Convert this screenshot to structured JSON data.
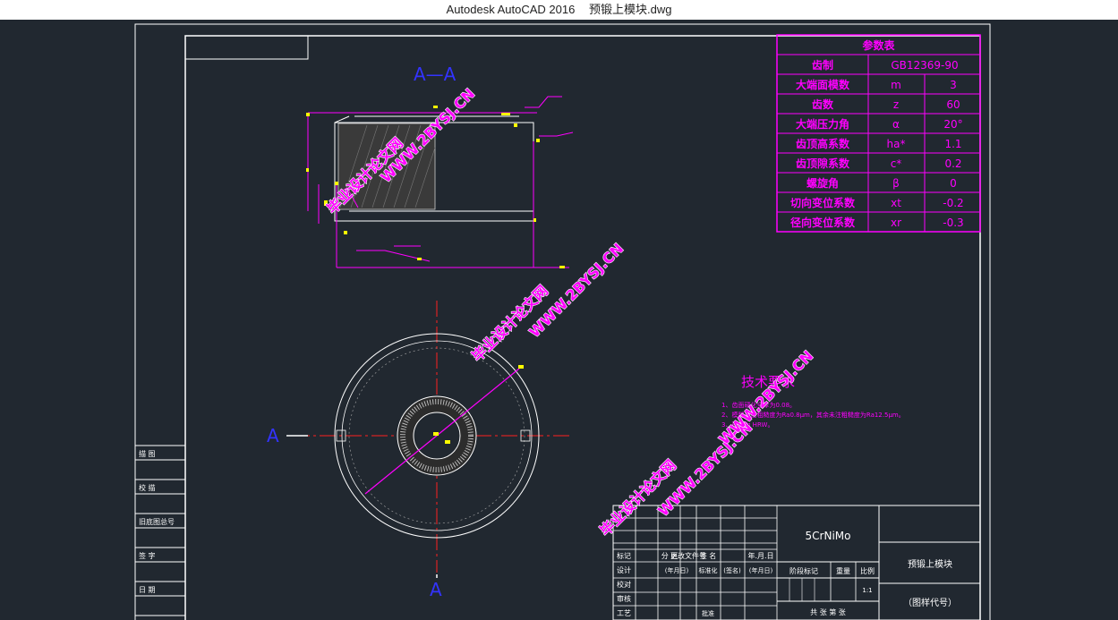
{
  "window": {
    "app_title": "Autodesk AutoCAD 2016",
    "file_name": "预锻上模块.dwg"
  },
  "colors": {
    "background": "#212830",
    "frame": "#ffffff",
    "magenta": "#ff00ff",
    "section_label": "#3333ff",
    "center_line": "#ff2020",
    "yellow_marker": "#ffff00"
  },
  "drawing": {
    "section_title": "A—A",
    "section_mark_left": "A",
    "section_mark_bottom": "A"
  },
  "param_table": {
    "title": "参数表",
    "rows": [
      {
        "name": "齿制",
        "symbol": "",
        "value": "GB12369-90"
      },
      {
        "name": "大端面模数",
        "symbol": "m",
        "value": "3"
      },
      {
        "name": "齿数",
        "symbol": "z",
        "value": "60"
      },
      {
        "name": "大端压力角",
        "symbol": "α",
        "value": "20°"
      },
      {
        "name": "齿顶高系数",
        "symbol": "ha*",
        "value": "1.1"
      },
      {
        "name": "齿顶隙系数",
        "symbol": "c*",
        "value": "0.2"
      },
      {
        "name": "螺旋角",
        "symbol": "β",
        "value": "0"
      },
      {
        "name": "切向变位系数",
        "symbol": "xt",
        "value": "-0.2"
      },
      {
        "name": "径向变位系数",
        "symbol": "xr",
        "value": "-0.3"
      }
    ]
  },
  "tech_req": {
    "title": "技术要求",
    "lines": [
      "1、齿面硬化全厚为0.08。",
      "2、模膛表面粗糙度为Ra0.8μm，其余未注粗糙度为Ra12.5μm。",
      "3、硬度为 HRW。"
    ]
  },
  "watermarks": {
    "text_cn": "毕业设计论文网",
    "text_url": "WWW.2BYSJ.CN"
  },
  "left_strip": {
    "labels": [
      "描 图",
      "校 描",
      "旧底图总号",
      "签 字",
      "日 期"
    ]
  },
  "title_block": {
    "material": "5CrNiMo",
    "drawing_name": "预锻上模块",
    "drawing_code": "（图样代号）",
    "rev_headers": [
      "标记",
      "分 区",
      "更改文件号",
      "签 名",
      "年.月.日"
    ],
    "sign_rows": [
      {
        "label": "设计",
        "c1": "(年月日)",
        "c2": "标准化",
        "c3": "(签名)",
        "c4": "(年月日)"
      },
      {
        "label": "校对",
        "c1": "",
        "c2": "",
        "c3": "",
        "c4": ""
      },
      {
        "label": "审核",
        "c1": "",
        "c2": "",
        "c3": "",
        "c4": ""
      },
      {
        "label": "工艺",
        "c1": "",
        "c2": "批准",
        "c3": "",
        "c4": ""
      }
    ],
    "stage_headers": [
      "阶段标记",
      "重量",
      "比例"
    ],
    "scale_value": "1:1",
    "sheet_text": "共 张 第 张"
  }
}
